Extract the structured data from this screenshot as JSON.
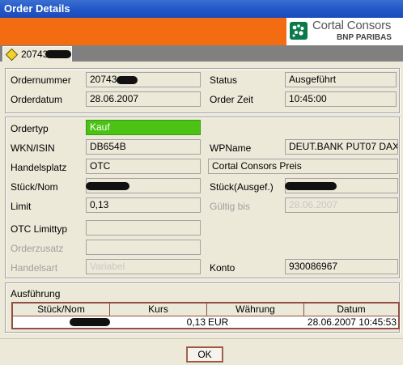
{
  "window": {
    "title": "Order Details"
  },
  "brand": {
    "name": "Cortal Consors",
    "sub": "BNP PARIBAS",
    "icon": "cortal-consors-logo"
  },
  "tab": {
    "label": "20743",
    "icon": "diamond-icon"
  },
  "header": {
    "ordernummer_label": "Ordernummer",
    "ordernummer_value": "20743",
    "status_label": "Status",
    "status_value": "Ausgeführt",
    "orderdatum_label": "Orderdatum",
    "orderdatum_value": "28.06.2007",
    "orderzeit_label": "Order Zeit",
    "orderzeit_value": "10:45:00"
  },
  "details": {
    "ordertyp_label": "Ordertyp",
    "ordertyp_value": "Kauf",
    "wkn_label": "WKN/ISIN",
    "wkn_value": "DB654B",
    "wpname_label": "WPName",
    "wpname_value": "DEUT.BANK PUT07 DAX",
    "handelsplatz_label": "Handelsplatz",
    "handelsplatz_value": "OTC",
    "preis_value": "Cortal Consors Preis",
    "stueck_label": "Stück/Nom",
    "stueck_ausgef_label": "Stück(Ausgef.)",
    "limit_label": "Limit",
    "limit_value": "0,13",
    "gueltig_label": "Gültig bis",
    "gueltig_value": "28.06.2007",
    "otc_limittyp_label": "OTC Limittyp",
    "orderzusatz_label": "Orderzusatz",
    "handelsart_label": "Handelsart",
    "handelsart_value": "Variabel",
    "konto_label": "Konto",
    "konto_value": "930086967"
  },
  "execution": {
    "section_label": "Ausführung",
    "columns": [
      "Stück/Nom",
      "Kurs",
      "Währung",
      "Datum"
    ],
    "rows": [
      {
        "kurs": "0,13",
        "waehrung": "EUR",
        "datum": "28.06.2007 10:45:53"
      }
    ]
  },
  "footer": {
    "ok_label": "OK"
  }
}
